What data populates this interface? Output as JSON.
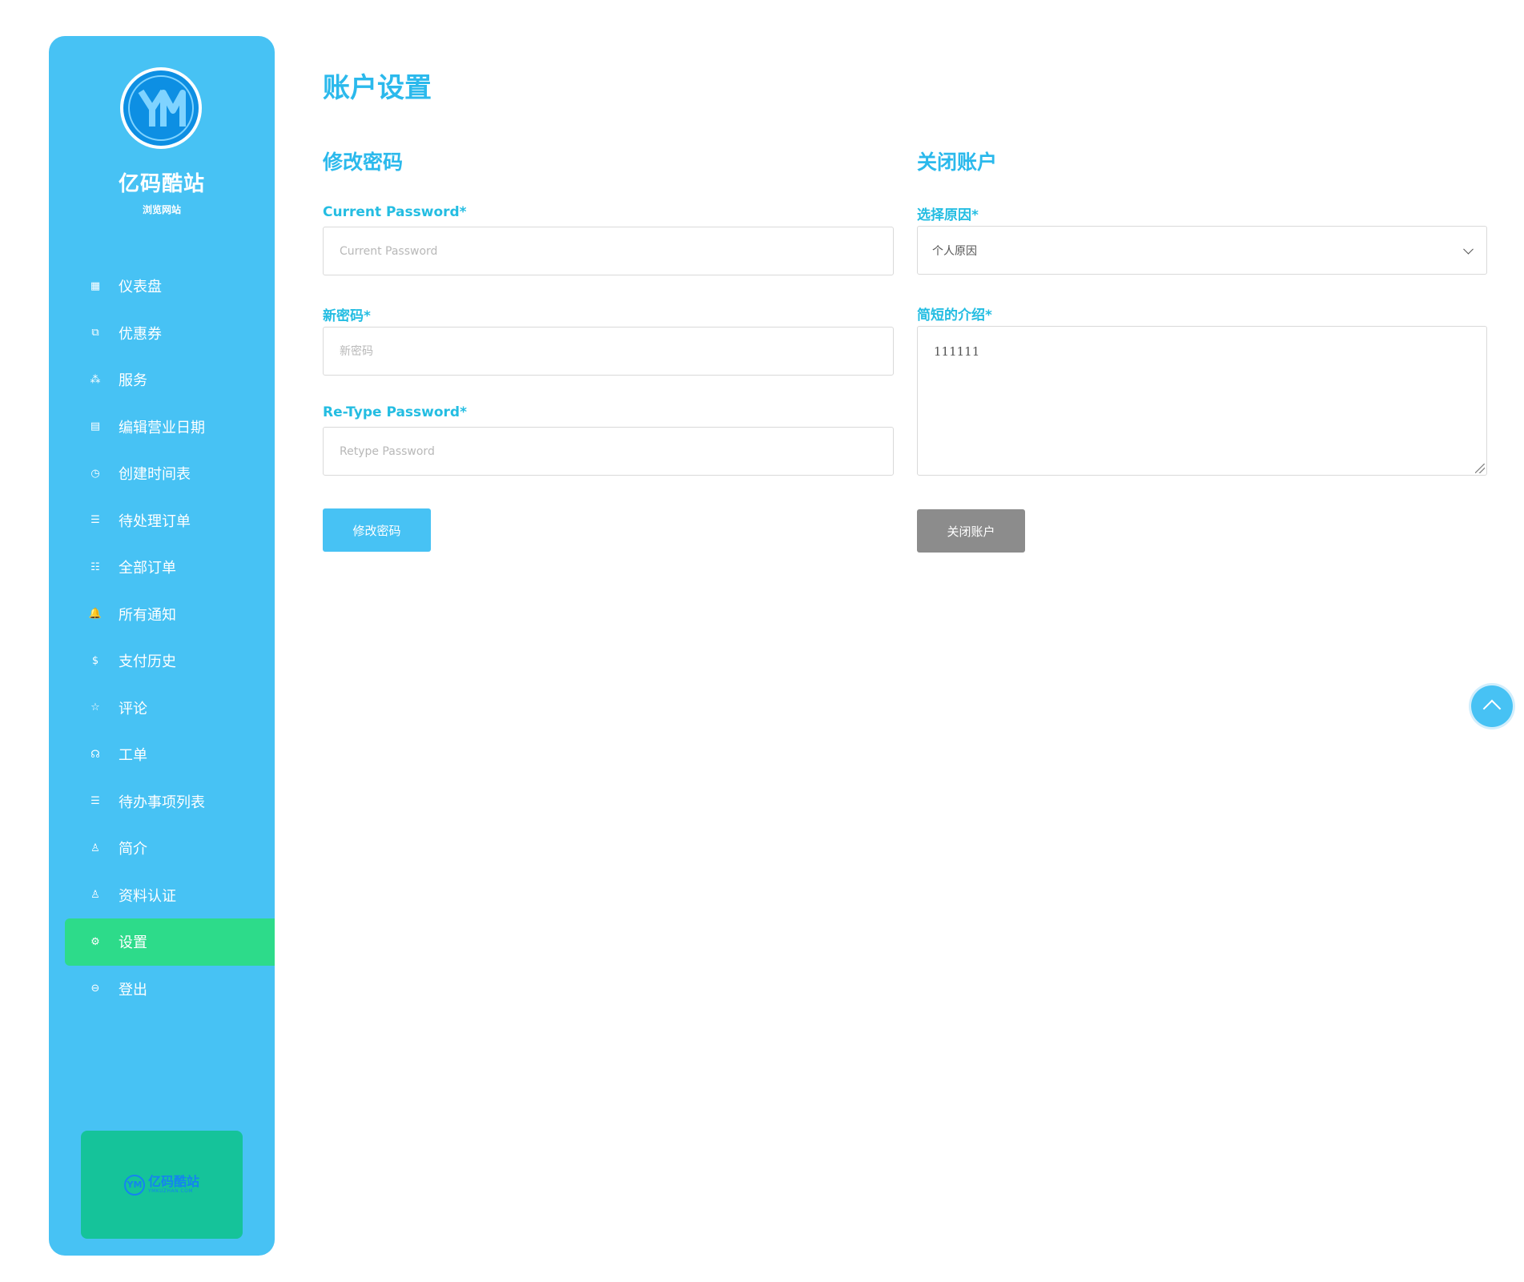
{
  "brand": {
    "name": "亿码酷站",
    "subtitle": "浏览网站",
    "logo_text": "YM",
    "promo_text": "亿码酷站",
    "promo_sub": "YMKUZHAN.COM"
  },
  "sidebar": {
    "items": [
      {
        "label": "仪表盘",
        "icon": "grid-icon",
        "glyph": "▦"
      },
      {
        "label": "优惠券",
        "icon": "coupon-icon",
        "glyph": "⧉"
      },
      {
        "label": "服务",
        "icon": "services-icon",
        "glyph": "⁂"
      },
      {
        "label": "编辑营业日期",
        "icon": "calendar-icon",
        "glyph": "▤"
      },
      {
        "label": "创建时间表",
        "icon": "clock-icon",
        "glyph": "◷"
      },
      {
        "label": "待处理订单",
        "icon": "pending-list-icon",
        "glyph": "☰"
      },
      {
        "label": "全部订单",
        "icon": "checklist-icon",
        "glyph": "☷"
      },
      {
        "label": "所有通知",
        "icon": "bell-icon",
        "glyph": "🔔"
      },
      {
        "label": "支付历史",
        "icon": "dollar-icon",
        "glyph": "$"
      },
      {
        "label": "评论",
        "icon": "star-icon",
        "glyph": "☆"
      },
      {
        "label": "工单",
        "icon": "headset-icon",
        "glyph": "☊"
      },
      {
        "label": "待办事项列表",
        "icon": "todo-list-icon",
        "glyph": "☰"
      },
      {
        "label": "简介",
        "icon": "user-icon",
        "glyph": "♙"
      },
      {
        "label": "资料认证",
        "icon": "user-verify-icon",
        "glyph": "♙"
      },
      {
        "label": "设置",
        "icon": "gear-icon",
        "glyph": "⚙",
        "active": true
      },
      {
        "label": "登出",
        "icon": "logout-icon",
        "glyph": "⊖"
      }
    ]
  },
  "page": {
    "title": "账户设置"
  },
  "change_password": {
    "title": "修改密码",
    "current_label": "Current Password*",
    "current_placeholder": "Current Password",
    "new_label": "新密码*",
    "new_placeholder": "新密码",
    "retype_label": "Re-Type Password*",
    "retype_placeholder": "Retype Password",
    "button": "修改密码"
  },
  "close_account": {
    "title": "关闭账户",
    "reason_label": "选择原因*",
    "reason_value": "个人原因",
    "intro_label": "简短的介绍*",
    "intro_value": "111111",
    "button": "关闭账户"
  },
  "colors": {
    "sidebar_bg": "#47c2f4",
    "active_item": "#2ddb8a",
    "accent_text": "#2bb9ec",
    "promo_bg": "#15c39a",
    "close_button": "#8c8c8c"
  }
}
